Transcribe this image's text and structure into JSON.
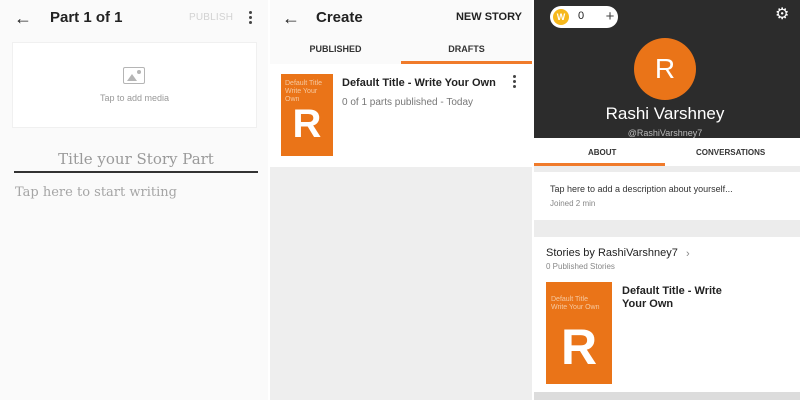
{
  "editor": {
    "title": "Part 1 of 1",
    "publish_label": "PUBLISH",
    "media_label": "Tap to add media",
    "title_placeholder": "Title your Story Part",
    "body_placeholder": "Tap here to start writing"
  },
  "create": {
    "title": "Create",
    "new_story_label": "NEW STORY",
    "tabs": [
      {
        "label": "PUBLISHED",
        "active": false
      },
      {
        "label": "DRAFTS",
        "active": true
      }
    ],
    "draft": {
      "title": "Default Title - Write Your Own",
      "meta": "0 of 1 parts published - Today",
      "cover_text": "Default Title Write Your Own",
      "cover_letter": "R"
    }
  },
  "profile": {
    "coin_count": "0",
    "avatar_letter": "R",
    "name": "Rashi Varshney",
    "handle": "@RashiVarshney7",
    "tabs": [
      {
        "label": "ABOUT",
        "active": true
      },
      {
        "label": "CONVERSATIONS",
        "active": false
      }
    ],
    "about_description": "Tap here to add a description about yourself...",
    "joined": "Joined 2 min",
    "stories_heading": "Stories by RashiVarshney7",
    "published_count": "0 Published Stories",
    "story": {
      "title": "Default Title - Write Your Own",
      "cover_text": "Default Title Write Your Own",
      "cover_letter": "R"
    }
  },
  "colors": {
    "accent": "#f07b2b",
    "cover": "#ea7418",
    "header_dark": "#2c2c2c",
    "coin": "#f6b81c"
  },
  "icons": [
    "back-arrow-icon",
    "more-vert-icon",
    "image-icon",
    "coin-icon",
    "plus-icon",
    "gear-icon",
    "chevron-right-icon"
  ]
}
